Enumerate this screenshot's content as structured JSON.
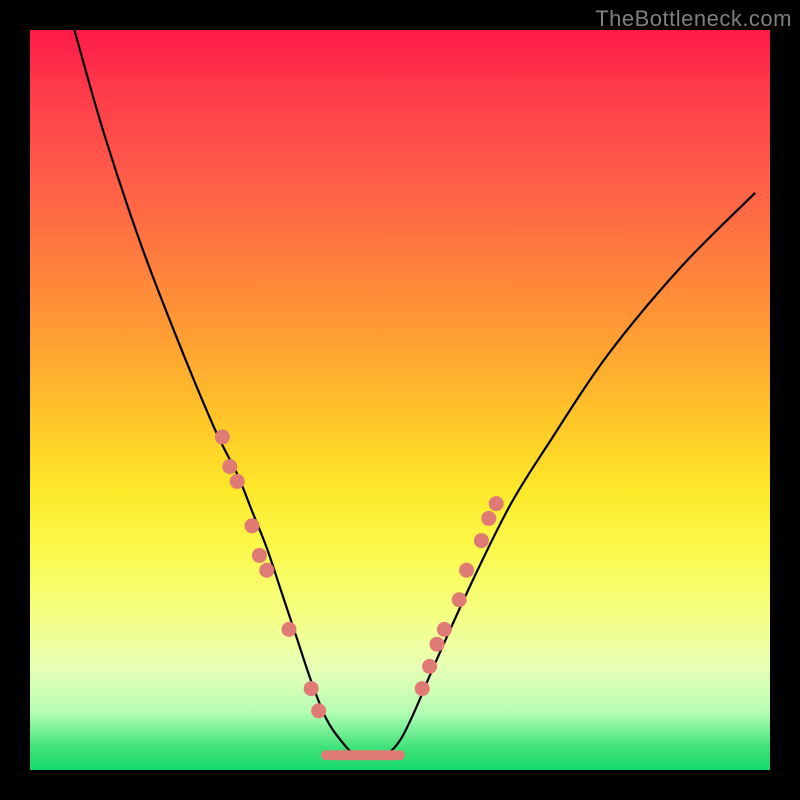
{
  "watermark": "TheBottleneck.com",
  "chart_data": {
    "type": "line",
    "title": "",
    "xlabel": "",
    "ylabel": "",
    "xlim": [
      0,
      100
    ],
    "ylim": [
      0,
      100
    ],
    "grid": false,
    "legend": false,
    "series": [
      {
        "name": "bottleneck-curve",
        "x": [
          6,
          10,
          15,
          20,
          25,
          28,
          30,
          32,
          34,
          36,
          38,
          40,
          42,
          44,
          46,
          48,
          50,
          52,
          55,
          60,
          65,
          70,
          78,
          88,
          98
        ],
        "y": [
          100,
          86,
          71,
          58,
          46,
          40,
          35,
          30,
          24,
          18,
          12,
          7,
          4,
          2,
          2,
          2,
          4,
          8,
          15,
          26,
          36,
          44,
          56,
          68,
          78
        ]
      }
    ],
    "markers_left": {
      "name": "left-branch-points",
      "color": "#e07a74",
      "points": [
        {
          "x": 26,
          "y": 45
        },
        {
          "x": 27,
          "y": 41
        },
        {
          "x": 28,
          "y": 39
        },
        {
          "x": 30,
          "y": 33
        },
        {
          "x": 31,
          "y": 29
        },
        {
          "x": 32,
          "y": 27
        },
        {
          "x": 35,
          "y": 19
        },
        {
          "x": 38,
          "y": 11
        },
        {
          "x": 39,
          "y": 8
        }
      ]
    },
    "markers_right": {
      "name": "right-branch-points",
      "color": "#e07a74",
      "points": [
        {
          "x": 53,
          "y": 11
        },
        {
          "x": 54,
          "y": 14
        },
        {
          "x": 55,
          "y": 17
        },
        {
          "x": 56,
          "y": 19
        },
        {
          "x": 58,
          "y": 23
        },
        {
          "x": 59,
          "y": 27
        },
        {
          "x": 61,
          "y": 31
        },
        {
          "x": 62,
          "y": 34
        },
        {
          "x": 63,
          "y": 36
        }
      ]
    },
    "bottom_bar": {
      "name": "flat-segment",
      "color": "#e07a74",
      "x_start": 40,
      "x_end": 50,
      "y": 2,
      "thickness": 10
    },
    "gradient_stops": [
      {
        "pos": 0,
        "color": "#ff1a47"
      },
      {
        "pos": 50,
        "color": "#ffc728"
      },
      {
        "pos": 75,
        "color": "#fbf94b"
      },
      {
        "pos": 100,
        "color": "#17d86b"
      }
    ]
  }
}
